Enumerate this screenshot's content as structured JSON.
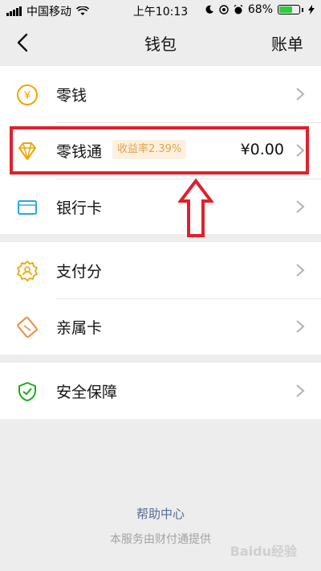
{
  "status_bar": {
    "carrier": "中国移动",
    "time": "上午10:13",
    "battery": "68%",
    "battery_level": 0.68
  },
  "nav": {
    "title": "钱包",
    "right_action": "账单"
  },
  "wallet": {
    "change": {
      "label": "零钱",
      "icon": "yuan-coin-icon"
    },
    "lingqiantong": {
      "label": "零钱通",
      "badge": "收益率2.39%",
      "amount": "¥0.00",
      "icon": "diamond-icon"
    },
    "bank_card": {
      "label": "银行卡",
      "icon": "card-icon"
    }
  },
  "services": {
    "pay_score": {
      "label": "支付分",
      "icon": "badge-icon"
    },
    "family_card": {
      "label": "亲属卡",
      "icon": "family-card-icon"
    }
  },
  "security": {
    "label": "安全保障",
    "icon": "shield-icon"
  },
  "footer": {
    "help": "帮助中心",
    "provider": "本服务由财付通提供"
  },
  "colors": {
    "accent_orange": "#f0a500",
    "accent_blue": "#2da7e0",
    "accent_green": "#1aad19",
    "highlight_red": "#e0202c",
    "link_blue": "#576b95"
  },
  "watermark": "Baidu经验"
}
